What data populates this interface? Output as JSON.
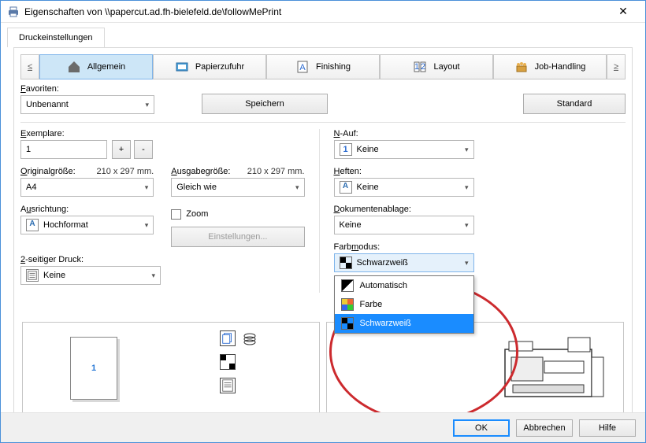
{
  "titlebar": {
    "text": "Eigenschaften von \\\\papercut.ad.fh-bielefeld.de\\followMePrint"
  },
  "main_tab": {
    "label": "Druckeinstellungen"
  },
  "nav": {
    "prev": "≤",
    "next": "≥",
    "tabs": [
      "Allgemein",
      "Papierzufuhr",
      "Finishing",
      "Layout",
      "Job-Handling"
    ]
  },
  "favorites": {
    "label_html": "Favoriten:",
    "value": "Unbenannt",
    "save_label": "Speichern",
    "standard_label": "Standard"
  },
  "left": {
    "copies": {
      "label": "Exemplare:",
      "value": "1",
      "plus": "+",
      "minus": "-"
    },
    "orig": {
      "label": "Originalgröße:",
      "hint": "210 x 297 mm.",
      "value": "A4"
    },
    "orient": {
      "label": "Ausrichtung:",
      "value": "Hochformat"
    },
    "duplex": {
      "label": "2-seitiger Druck:",
      "value": "Keine"
    },
    "output": {
      "label": "Ausgabegröße:",
      "hint": "210 x 297 mm.",
      "value": "Gleich wie"
    },
    "zoom": {
      "label": "Zoom",
      "settings_btn": "Einstellungen..."
    }
  },
  "right": {
    "nauf": {
      "label": "N-Auf:",
      "value": "Keine",
      "prefix": "1"
    },
    "heften": {
      "label": "Heften:",
      "value": "Keine"
    },
    "ablage": {
      "label": "Dokumentenablage:",
      "value": "Keine"
    },
    "farbmodus": {
      "label": "Farbmodus:",
      "value": "Schwarzweiß",
      "options": [
        "Automatisch",
        "Farbe",
        "Schwarzweiß"
      ]
    }
  },
  "preview": {
    "page_number": "1"
  },
  "footer": {
    "ok": "OK",
    "cancel": "Abbrechen",
    "help": "Hilfe"
  }
}
